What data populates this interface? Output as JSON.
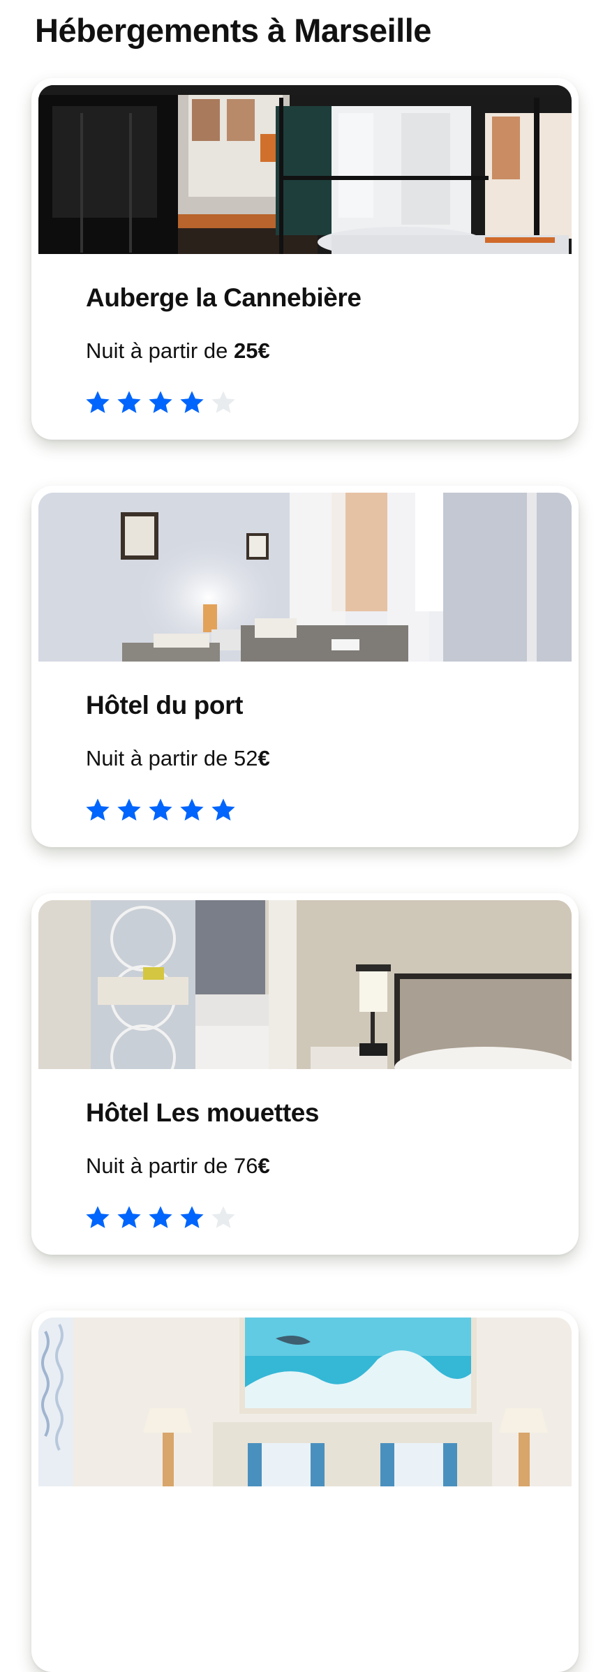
{
  "page": {
    "title": "Hébergements à Marseille"
  },
  "colors": {
    "star_filled": "#0065fc",
    "star_empty": "#e9ecef"
  },
  "listings": [
    {
      "name": "Auberge la Cannebière",
      "price_prefix": "Nuit à partir de",
      "price_amount": "25",
      "price_currency": "€",
      "rating": 4,
      "rating_max": 5,
      "photo": "hostel-dorm-bunk-beds-photo"
    },
    {
      "name": "Hôtel du port",
      "price_prefix": "Nuit à partir de",
      "price_amount": "52",
      "price_currency": "€",
      "rating": 5,
      "rating_max": 5,
      "photo": "hotel-twin-room-window-photo"
    },
    {
      "name": "Hôtel Les mouettes",
      "price_prefix": "Nuit à partir de",
      "price_amount": "76",
      "price_currency": "€",
      "rating": 4,
      "rating_max": 5,
      "photo": "hotel-room-mirror-bed-photo"
    },
    {
      "name": "",
      "price_prefix": "",
      "price_amount": "",
      "price_currency": "",
      "photo": "hotel-room-wave-painting-photo"
    }
  ]
}
